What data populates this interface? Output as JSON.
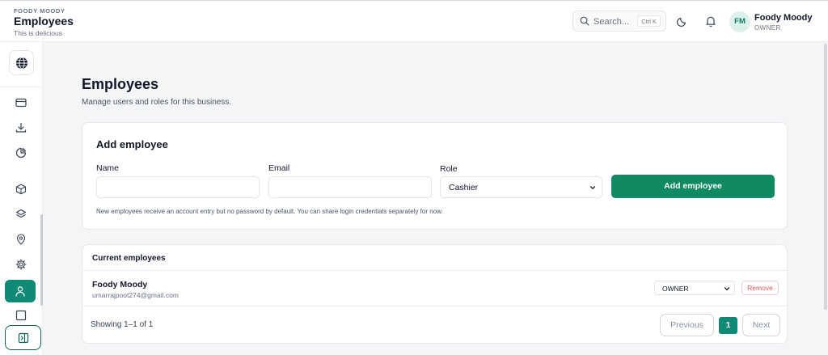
{
  "header": {
    "org_label": "FOODY MOODY",
    "title": "Employees",
    "subtitle": "This is delicious",
    "search_placeholder": "Search...",
    "search_shortcut": "Ctrl K",
    "avatar_initials": "FM",
    "user_name": "Foody Moody",
    "user_role": "OWNER"
  },
  "sidebar": {
    "items": [
      "logo-globe",
      "billing",
      "downloads",
      "reports",
      "products",
      "layers",
      "locations",
      "settings",
      "employees",
      "blank"
    ],
    "active": "employees"
  },
  "page": {
    "title": "Employees",
    "subtitle": "Manage users and roles for this business."
  },
  "add_form": {
    "heading": "Add employee",
    "name_label": "Name",
    "name_value": "",
    "email_label": "Email",
    "email_value": "",
    "role_label": "Role",
    "role_value": "Cashier",
    "submit_label": "Add employee",
    "note": "New employees receive an account entry but no password by default. You can share login credentials separately for now."
  },
  "employees": {
    "heading": "Current employees",
    "rows": [
      {
        "name": "Foody Moody",
        "email": "umarrajpoot274@gmail.com",
        "role": "OWNER",
        "remove_label": "Remove"
      }
    ],
    "showing": "Showing 1–1 of 1",
    "prev_label": "Previous",
    "current_page": "1",
    "next_label": "Next"
  },
  "colors": {
    "accent": "#0f8a75",
    "primary_button": "#0f8a62",
    "danger": "#dc5b5b"
  }
}
